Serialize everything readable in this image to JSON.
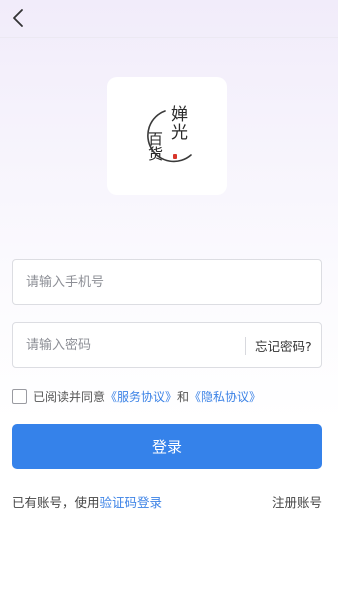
{
  "header": {
    "back_icon": "chevron-left-icon"
  },
  "logo": {
    "text_vertical": "婵光",
    "text_left": "百货"
  },
  "form": {
    "phone_placeholder": "请输入手机号",
    "phone_value": "",
    "password_placeholder": "请输入密码",
    "password_value": "",
    "forgot_label": "忘记密码?"
  },
  "agreement": {
    "checked": false,
    "prefix": "已阅读并同意",
    "service_link": "《服务协议》",
    "conjunction": "和",
    "privacy_link": "《隐私协议》"
  },
  "login_button": {
    "label": "登录",
    "color": "#3582ea"
  },
  "footer": {
    "has_account_text": "已有账号，使用",
    "code_login_link": "验证码登录",
    "register_label": "注册账号"
  },
  "colors": {
    "accent": "#3582ea",
    "link": "#3b82e6"
  }
}
